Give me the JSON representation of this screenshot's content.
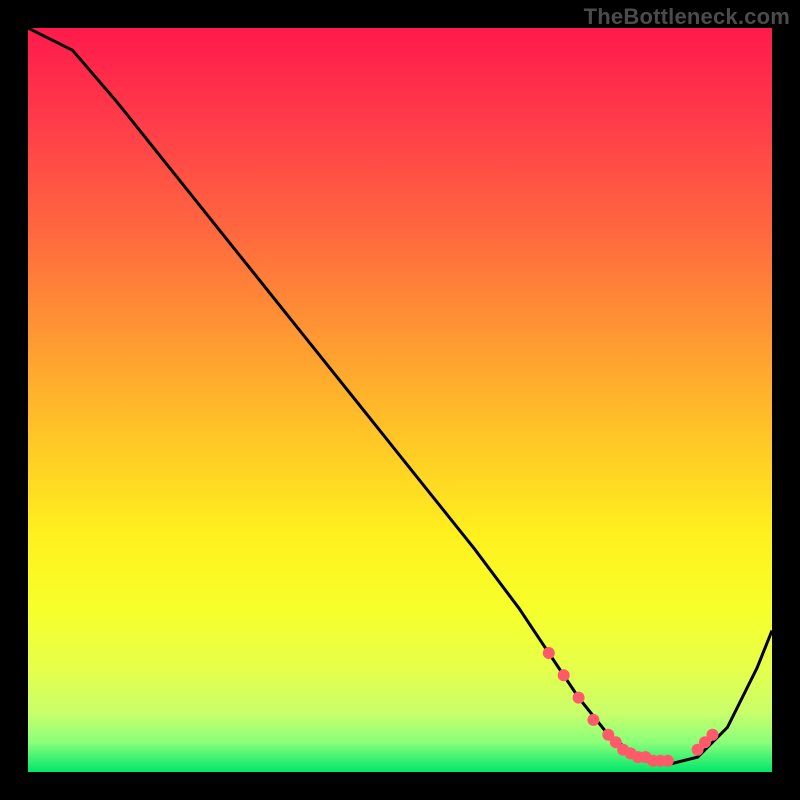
{
  "watermark": "TheBottleneck.com",
  "colors": {
    "bg": "#000000",
    "gradient_stops": [
      {
        "offset": "0%",
        "color": "#ff1a4b"
      },
      {
        "offset": "12%",
        "color": "#ff3a4a"
      },
      {
        "offset": "28%",
        "color": "#ff6a3e"
      },
      {
        "offset": "42%",
        "color": "#ff9a32"
      },
      {
        "offset": "55%",
        "color": "#ffc626"
      },
      {
        "offset": "68%",
        "color": "#fff01e"
      },
      {
        "offset": "78%",
        "color": "#f7ff2a"
      },
      {
        "offset": "86%",
        "color": "#e6ff4a"
      },
      {
        "offset": "92%",
        "color": "#c8ff6a"
      },
      {
        "offset": "96%",
        "color": "#8bff7a"
      },
      {
        "offset": "100%",
        "color": "#00e66a"
      }
    ],
    "line": "#000000",
    "marker": "#ff5a6a"
  },
  "chart_data": {
    "type": "line",
    "title": "",
    "xlabel": "",
    "ylabel": "",
    "xlim": [
      0,
      100
    ],
    "ylim": [
      0,
      100
    ],
    "x": [
      0,
      6,
      12,
      20,
      28,
      36,
      44,
      52,
      60,
      66,
      70,
      74,
      78,
      82,
      86,
      90,
      94,
      98,
      100
    ],
    "y": [
      100,
      97,
      90,
      80,
      70,
      60,
      50,
      40,
      30,
      22,
      16,
      10,
      5,
      2,
      1,
      2,
      6,
      14,
      19
    ],
    "markers_x": [
      70,
      72,
      74,
      76,
      78,
      79,
      80,
      81,
      82,
      83,
      84,
      85,
      86,
      90,
      91,
      92
    ],
    "markers_y": [
      16,
      13,
      10,
      7,
      5,
      4,
      3,
      2.5,
      2,
      2,
      1.5,
      1.5,
      1.5,
      3,
      4,
      5
    ]
  }
}
